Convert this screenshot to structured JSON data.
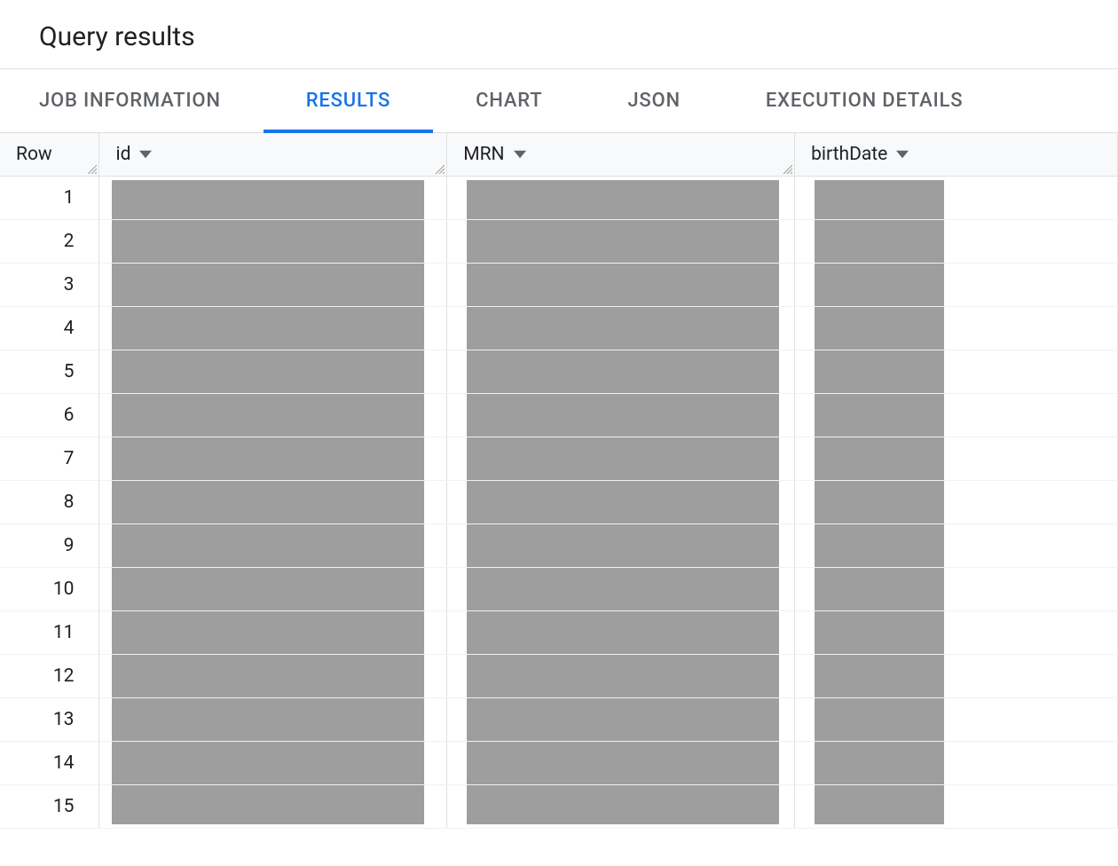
{
  "header": {
    "title": "Query results"
  },
  "tabs": {
    "items": [
      {
        "label": "JOB INFORMATION",
        "active": false
      },
      {
        "label": "RESULTS",
        "active": true
      },
      {
        "label": "CHART",
        "active": false
      },
      {
        "label": "JSON",
        "active": false
      },
      {
        "label": "EXECUTION DETAILS",
        "active": false
      }
    ]
  },
  "table": {
    "columns": {
      "row": "Row",
      "id": "id",
      "mrn": "MRN",
      "birthDate": "birthDate"
    },
    "rows": [
      {
        "n": "1"
      },
      {
        "n": "2"
      },
      {
        "n": "3"
      },
      {
        "n": "4"
      },
      {
        "n": "5"
      },
      {
        "n": "6"
      },
      {
        "n": "7"
      },
      {
        "n": "8"
      },
      {
        "n": "9"
      },
      {
        "n": "10"
      },
      {
        "n": "11"
      },
      {
        "n": "12"
      },
      {
        "n": "13"
      },
      {
        "n": "14"
      },
      {
        "n": "15"
      }
    ]
  }
}
